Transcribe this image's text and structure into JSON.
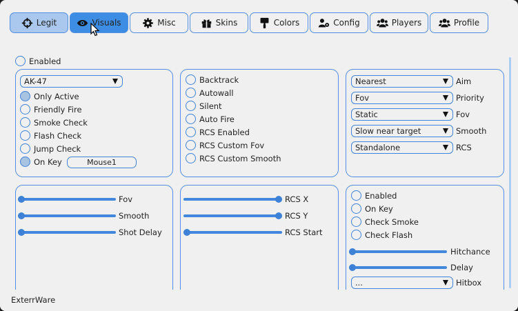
{
  "tabs": [
    {
      "label": "Legit",
      "icon": "crosshair-icon"
    },
    {
      "label": "Visuals",
      "icon": "eye-icon"
    },
    {
      "label": "Misc",
      "icon": "gear-icon"
    },
    {
      "label": "Skins",
      "icon": "gift-icon"
    },
    {
      "label": "Colors",
      "icon": "paint-roller-icon"
    },
    {
      "label": "Config",
      "icon": "users-cog-icon"
    },
    {
      "label": "Players",
      "icon": "users-icon"
    },
    {
      "label": "Profile",
      "icon": "users-icon"
    }
  ],
  "selected_tab": "Legit",
  "hovered_tab": "Visuals",
  "enabled_label": "Enabled",
  "weapon_panel": {
    "weapon_select": "AK-47",
    "checks": [
      {
        "label": "Only Active",
        "checked": true
      },
      {
        "label": "Friendly Fire",
        "checked": false
      },
      {
        "label": "Smoke Check",
        "checked": false
      },
      {
        "label": "Flash Check",
        "checked": false
      },
      {
        "label": "Jump Check",
        "checked": false
      },
      {
        "label": "On Key",
        "checked": true
      }
    ],
    "key_button": "Mouse1"
  },
  "options_panel": {
    "checks": [
      {
        "label": "Backtrack",
        "checked": false
      },
      {
        "label": "Autowall",
        "checked": false
      },
      {
        "label": "Silent",
        "checked": false
      },
      {
        "label": "Auto Fire",
        "checked": false
      },
      {
        "label": "RCS Enabled",
        "checked": false
      },
      {
        "label": "RCS Custom Fov",
        "checked": false
      },
      {
        "label": "RCS Custom Smooth",
        "checked": false
      }
    ]
  },
  "aim_panel": {
    "rows": [
      {
        "value": "Nearest",
        "label": "Aim"
      },
      {
        "value": "Fov",
        "label": "Priority"
      },
      {
        "value": "Static",
        "label": "Fov"
      },
      {
        "value": "Slow near target",
        "label": "Smooth"
      },
      {
        "value": "Standalone",
        "label": "RCS"
      }
    ]
  },
  "sliders_panel": {
    "sliders": [
      {
        "label": "Fov",
        "value": 0.0
      },
      {
        "label": "Smooth",
        "value": 0.0
      },
      {
        "label": "Shot Delay",
        "value": 0.0
      }
    ]
  },
  "rcs_panel": {
    "sliders": [
      {
        "label": "RCS X",
        "value": 1.0
      },
      {
        "label": "RCS Y",
        "value": 1.0
      },
      {
        "label": "RCS Start",
        "value": 0.0
      }
    ]
  },
  "trigger_panel": {
    "checks": [
      {
        "label": "Enabled",
        "checked": false
      },
      {
        "label": "On Key",
        "checked": false
      },
      {
        "label": "Check Smoke",
        "checked": false
      },
      {
        "label": "Check Flash",
        "checked": false
      }
    ],
    "sliders": [
      {
        "label": "Hitchance",
        "value": 0.0
      },
      {
        "label": "Delay",
        "value": 0.0
      }
    ],
    "hitbox_select": "...",
    "hitbox_label": "Hitbox"
  },
  "footer_text": "ExterrWare",
  "colors": {
    "accent": "#3e8de4",
    "border": "#4f8ee0",
    "background": "#f0f0f0"
  }
}
